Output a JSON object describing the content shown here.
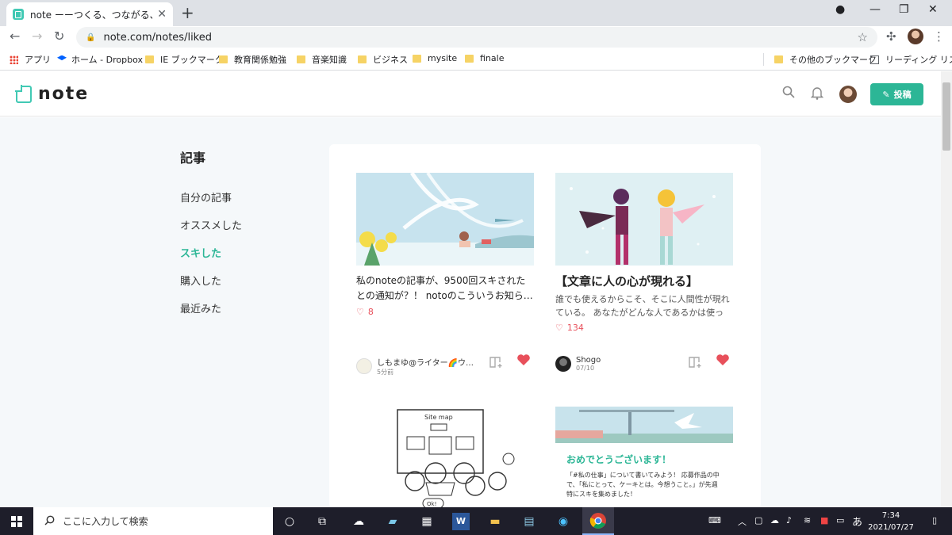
{
  "browser": {
    "tab_title": "note ーーつくる、つながる、とどける。",
    "url": "note.com/notes/liked",
    "bookmarks": [
      "アプリ",
      "ホーム - Dropbox",
      "IE ブックマーク",
      "教育関係勉強",
      "音楽知識",
      "ビジネス",
      "mysite",
      "finale"
    ],
    "other_bookmarks": "その他のブックマーク",
    "reading_list": "リーディング リスト"
  },
  "header": {
    "logo": "note",
    "post_button": "投稿"
  },
  "sidebar": {
    "title": "記事",
    "items": [
      "自分の記事",
      "オススメした",
      "スキした",
      "購入した",
      "最近みた"
    ],
    "active_index": 2
  },
  "cards": [
    {
      "title": "私のnoteの記事が、9500回スキされたとの通知が？！ notoのこういうお知ら…",
      "likes": "8",
      "author": "しもまゆ@ライター🌈ウ…",
      "date": "5分前"
    },
    {
      "title": "【文章に人の心が現れる】",
      "desc": "誰でも使えるからこそ、そこに人間性が現れている。 あなたがどんな人であるかは使って…",
      "likes": "134",
      "author": "Shogo",
      "date": "07/10"
    }
  ],
  "card3_image": {
    "caption": "Site map",
    "bubble": "Ok!"
  },
  "card4_image": {
    "heading": "おめでとうございます！",
    "body": "「#私の仕事」について書いてみよう！ 応募作品の中で、「私にとって、ケーキとは。今想うこと。」が先週特にスキを集めました！"
  },
  "taskbar": {
    "search_placeholder": "ここに入力して検索",
    "ime": "あ",
    "time": "7:34",
    "date": "2021/07/27"
  },
  "colors": {
    "accent": "#2cb696",
    "like": "#e8505b"
  }
}
